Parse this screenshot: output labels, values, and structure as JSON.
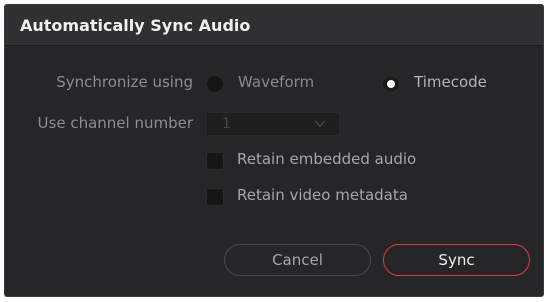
{
  "dialog": {
    "title": "Automatically Sync Audio"
  },
  "sync_using": {
    "label": "Synchronize using",
    "options": [
      {
        "label": "Waveform",
        "selected": false
      },
      {
        "label": "Timecode",
        "selected": true
      }
    ]
  },
  "channel": {
    "label": "Use channel number",
    "value": "1",
    "enabled": false
  },
  "checkboxes": [
    {
      "label": "Retain embedded audio",
      "checked": false
    },
    {
      "label": "Retain video metadata",
      "checked": false
    }
  ],
  "buttons": {
    "cancel_label": "Cancel",
    "sync_label": "Sync"
  },
  "colors": {
    "accent": "#e03a44",
    "background": "#262628",
    "titlebar": "#303033"
  }
}
